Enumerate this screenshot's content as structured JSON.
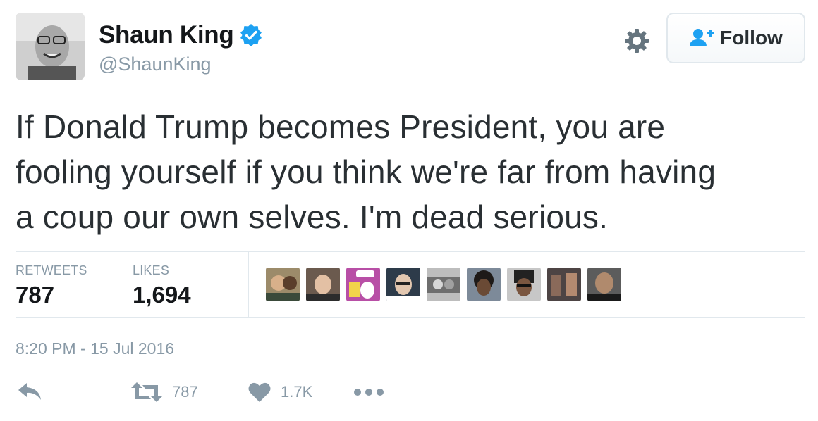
{
  "user": {
    "display_name": "Shaun King",
    "handle": "@ShaunKing",
    "verified": true
  },
  "follow_button": {
    "label": "Follow"
  },
  "tweet": {
    "lines": [
      "If Donald Trump becomes President, you are",
      "fooling yourself if you think we're far from having",
      "a coup our own selves. I'm dead serious."
    ]
  },
  "stats": {
    "retweets_label": "RETWEETS",
    "retweets_value": "787",
    "likes_label": "LIKES",
    "likes_value": "1,694"
  },
  "likers_count": 9,
  "timestamp": "8:20 PM - 15 Jul 2016",
  "actions": {
    "retweet_count": "787",
    "like_count": "1.7K"
  },
  "colors": {
    "verified_blue": "#1da1f2",
    "follow_icon_blue": "#1da1f2",
    "muted_gray": "#8899a6",
    "text": "#292f33"
  },
  "icons": [
    "verified-icon",
    "gear-icon",
    "follow-user-icon",
    "reply-icon",
    "retweet-icon",
    "heart-icon",
    "more-icon"
  ]
}
